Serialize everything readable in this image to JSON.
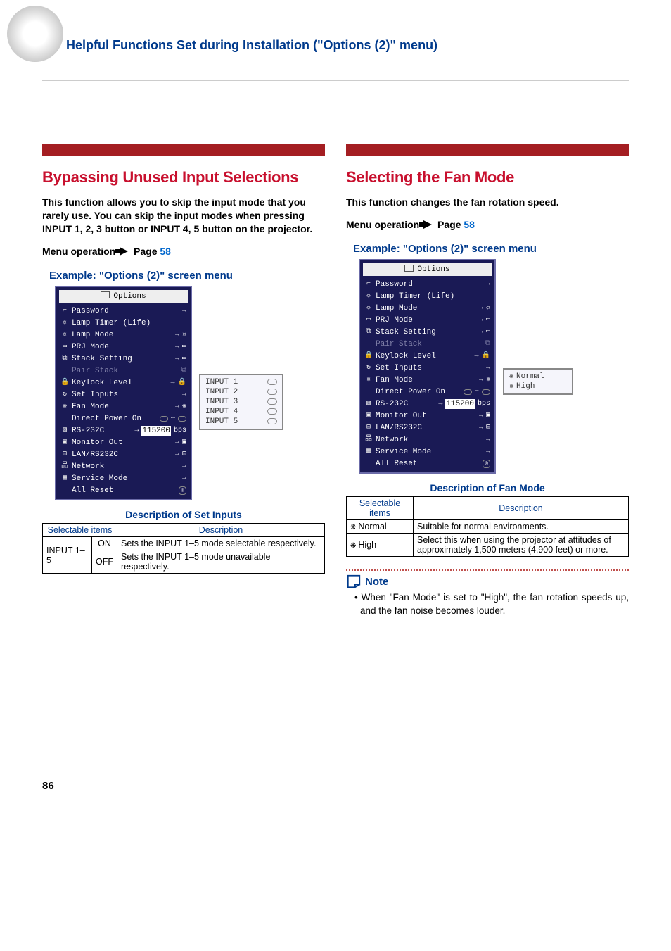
{
  "header": "Helpful Functions Set during Installation (\"Options (2)\" menu)",
  "page_number": "86",
  "left": {
    "title": "Bypassing Unused Input Selections",
    "body": "This function allows you to skip the input mode that you rarely use. You can skip the input modes when pressing INPUT 1, 2, 3 button or INPUT 4, 5 button on the projector.",
    "menu_op_pre": "Menu operation",
    "page_ref": "Page 58",
    "example_h": "Example: \"Options (2)\" screen menu",
    "osd_title": "Options",
    "osd_items": [
      {
        "icon": "⌐",
        "label": "Password",
        "arrow": "→"
      },
      {
        "icon": "☼",
        "label": "Lamp Timer (Life)",
        "arrow": ""
      },
      {
        "icon": "☼",
        "label": "Lamp Mode",
        "arrow": "→",
        "extra": "☼"
      },
      {
        "icon": "▭",
        "label": "PRJ Mode",
        "arrow": "→",
        "extra": "▭"
      },
      {
        "icon": "⧉",
        "label": "Stack Setting",
        "arrow": "→",
        "extra": "▭"
      },
      {
        "icon": "",
        "label": "Pair Stack",
        "arrow": "",
        "extra": "⧉",
        "dim": true
      },
      {
        "icon": "🔒",
        "label": "Keylock Level",
        "arrow": "→",
        "extra": "🔒"
      },
      {
        "icon": "↻",
        "label": "Set Inputs",
        "arrow": "→"
      },
      {
        "icon": "❋",
        "label": "Fan Mode",
        "arrow": "→",
        "extra": "❋"
      },
      {
        "icon": "",
        "label": "Direct Power On",
        "arrow": "",
        "pill": true,
        "dir": "⇨",
        "pill2": true
      },
      {
        "icon": "▧",
        "label": "RS-232C",
        "arrow": "→",
        "hl": "115200",
        "extra": "bps"
      },
      {
        "icon": "▣",
        "label": "Monitor Out",
        "arrow": "→",
        "extra": "▣"
      },
      {
        "icon": "⊟",
        "label": "LAN/RS232C",
        "arrow": "→",
        "extra": "⊟"
      },
      {
        "icon": "品",
        "label": "Network",
        "arrow": "→"
      },
      {
        "icon": "▦",
        "label": "Service Mode",
        "arrow": "→"
      },
      {
        "icon": "",
        "label": "All Reset",
        "arrow": "",
        "reset": "◎"
      }
    ],
    "popup_items": [
      "INPUT 1",
      "INPUT 2",
      "INPUT 3",
      "INPUT 4",
      "INPUT 5"
    ],
    "desc_h": "Description of Set Inputs",
    "table": {
      "th1": "Selectable items",
      "th2": "Description",
      "row_item": "INPUT 1–5",
      "r1a": "ON",
      "r1b": "Sets the INPUT 1–5 mode selectable respectively.",
      "r2a": "OFF",
      "r2b": "Sets the INPUT 1–5 mode unavailable respectively."
    }
  },
  "right": {
    "title": "Selecting the Fan Mode",
    "body": "This function changes the fan rotation speed.",
    "menu_op_pre": "Menu operation",
    "page_ref": "Page 58",
    "example_h": "Example: \"Options (2)\" screen menu",
    "osd_title": "Options",
    "popup_items": [
      {
        "ico": "❋",
        "label": "Normal"
      },
      {
        "ico": "❋",
        "label": "High"
      }
    ],
    "desc_h": "Description of Fan Mode",
    "table": {
      "th1": "Selectable items",
      "th2": "Description",
      "r1a": "Normal",
      "r1b": "Suitable for normal environments.",
      "r2a": "High",
      "r2b": "Select this when using the projector at attitudes of approximately 1,500 meters (4,900 feet) or more."
    },
    "note_label": "Note",
    "note_text": "• When \"Fan Mode\" is set to \"High\", the fan rotation speeds up, and the fan noise becomes louder."
  }
}
